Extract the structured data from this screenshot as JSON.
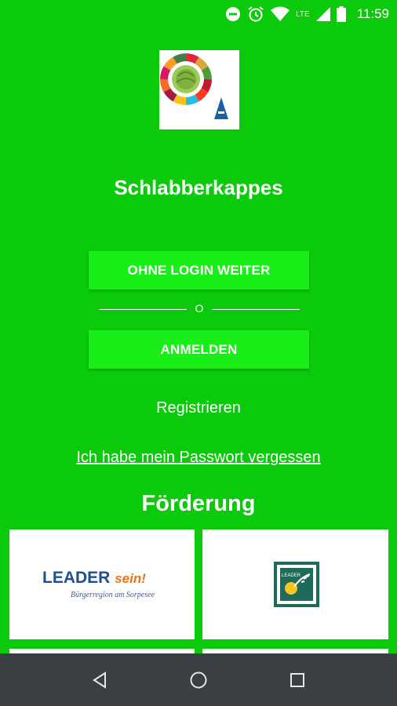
{
  "status_bar": {
    "time": "11:59",
    "network": "LTE",
    "icons": [
      "do-not-disturb-icon",
      "alarm-icon",
      "wifi-icon",
      "signal-icon",
      "battery-icon"
    ]
  },
  "app": {
    "title": "Schlabberkappes",
    "logo_icon": "cabbage-sdg-wheel-logo-icon"
  },
  "actions": {
    "continue_without_login": "OHNE LOGIN WEITER",
    "or_divider": "O",
    "login": "ANMELDEN",
    "register": "Registrieren",
    "forgot_password": "Ich habe mein Passwort vergessen"
  },
  "funding": {
    "heading": "Förderung",
    "sponsors": [
      {
        "name_main": "LEADER",
        "name_accent": "sein!",
        "subtitle": "Bürgerregion am Sorpesee"
      },
      {
        "name": "LEADER"
      }
    ]
  },
  "nav_bar": {
    "icons": [
      "back-icon",
      "home-icon",
      "recents-icon"
    ]
  },
  "colors": {
    "background": "#0bc90b",
    "button": "#19ee19",
    "nav_bar": "#3a3f44"
  }
}
